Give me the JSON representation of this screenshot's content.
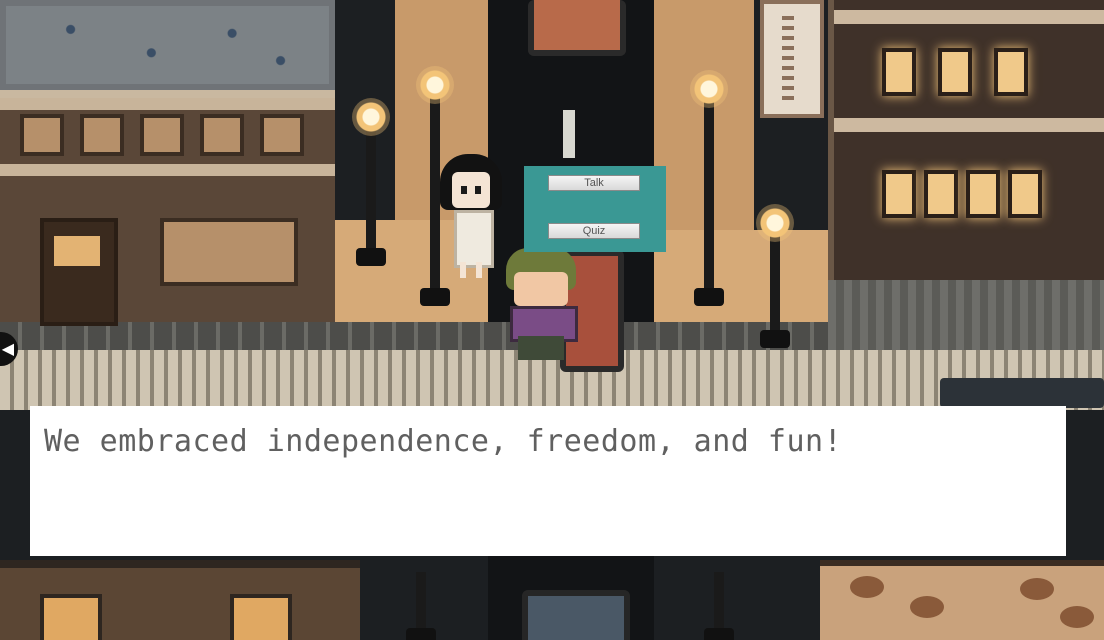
{
  "menu": {
    "talk_label": "Talk",
    "quiz_label": "Quiz"
  },
  "dialogue": {
    "text": "We embraced independence, freedom, and fun!"
  },
  "icons": {
    "left_arrow": "left-arrow-icon"
  },
  "colors": {
    "menu_panel": "#3a9894",
    "dialogue_bg": "#ffffff",
    "dialogue_text": "#606060"
  }
}
